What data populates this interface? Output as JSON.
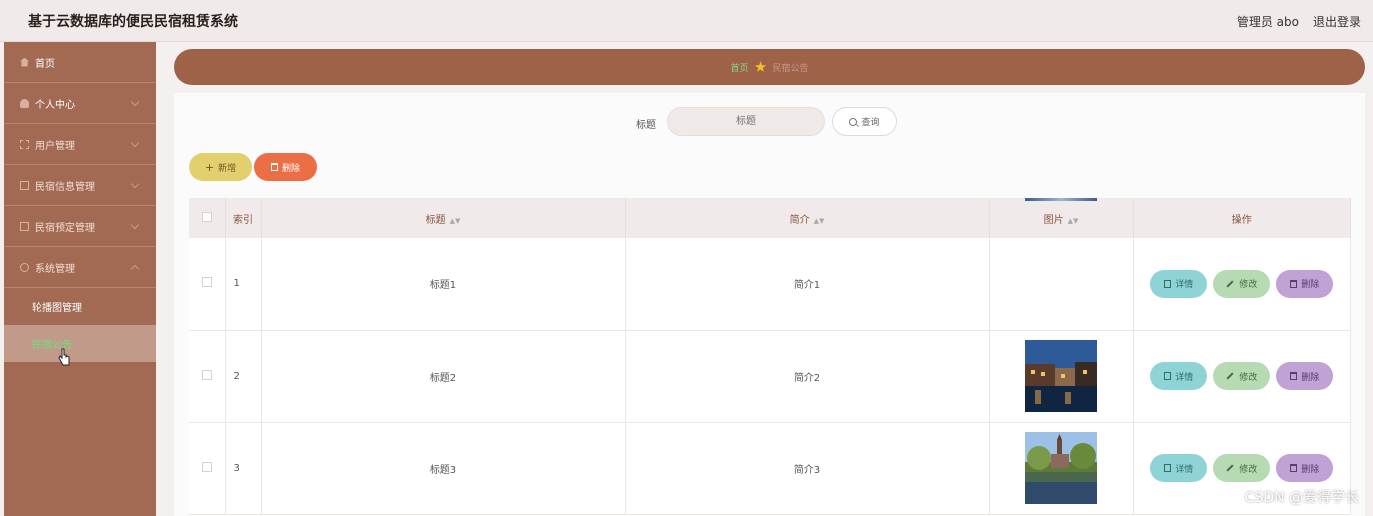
{
  "header": {
    "title": "基于云数据库的便民民宿租赁系统",
    "admin": "管理员 abo",
    "logout": "退出登录"
  },
  "sidebar": {
    "items": [
      {
        "label": "首页"
      },
      {
        "label": "个人中心"
      },
      {
        "label": "用户管理"
      },
      {
        "label": "民宿信息管理"
      },
      {
        "label": "民宿预定管理"
      },
      {
        "label": "系统管理"
      }
    ],
    "sub_items": [
      {
        "label": "轮播图管理"
      },
      {
        "label": "民宿公告"
      }
    ]
  },
  "breadcrumb": {
    "home": "首页",
    "current": "民宿公告"
  },
  "search": {
    "label": "标题",
    "placeholder": "标题",
    "button": "查询"
  },
  "actions": {
    "add": "新增",
    "delete": "删除"
  },
  "table": {
    "headers": {
      "index": "索引",
      "title": "标题",
      "summary": "简介",
      "image": "图片",
      "ops": "操作"
    },
    "rows": [
      {
        "index": "1",
        "title": "标题1",
        "summary": "简介1"
      },
      {
        "index": "2",
        "title": "标题2",
        "summary": "简介2"
      },
      {
        "index": "3",
        "title": "标题3",
        "summary": "简介3"
      }
    ],
    "ops": {
      "detail": "详情",
      "edit": "修改",
      "delete": "删除"
    }
  },
  "watermark": "CSDN @爱得学长",
  "colors": {
    "sidebar": "#a26a52",
    "breadcrumb": "#9d6248",
    "add": "#e2cf6e",
    "delete": "#ec6e45",
    "active_text": "#6ee07a"
  }
}
